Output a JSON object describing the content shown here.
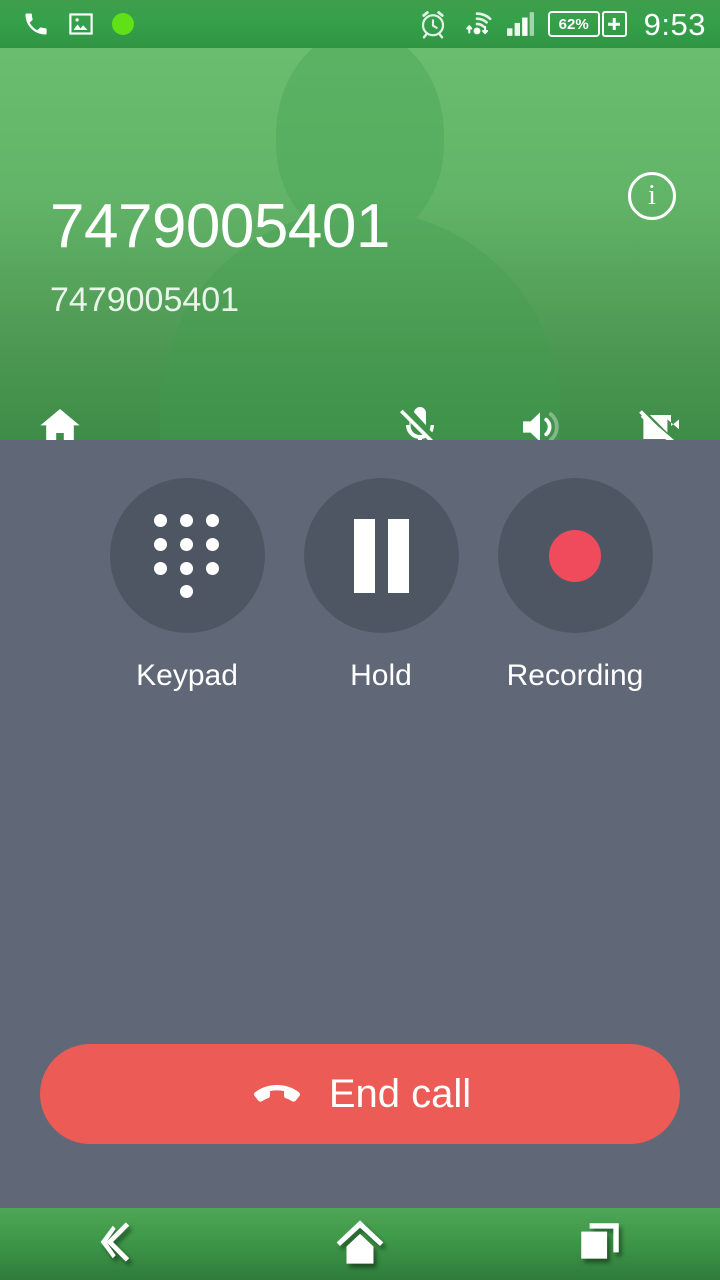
{
  "status_bar": {
    "time": "9:53",
    "battery_percent": "62%",
    "icons": [
      {
        "name": "phone-icon",
        "label": "call in progress"
      },
      {
        "name": "image-icon",
        "label": "screenshot captured"
      },
      {
        "name": "green-dot-icon",
        "label": "recording active"
      },
      {
        "name": "alarm-icon",
        "label": "alarm set"
      },
      {
        "name": "wifi-transfer-icon",
        "label": "wifi data transfer"
      },
      {
        "name": "signal-bars-icon",
        "label": "cellular signal"
      },
      {
        "name": "battery-icon",
        "label": "battery"
      },
      {
        "name": "plus-icon",
        "label": "battery plus"
      }
    ]
  },
  "call": {
    "caller_name": "7479005401",
    "caller_number": "7479005401",
    "info_glyph": "i",
    "header_actions": [
      {
        "name": "home-icon",
        "label": "Home"
      },
      {
        "name": "mic-off-icon",
        "label": "Mute"
      },
      {
        "name": "speaker-icon",
        "label": "Speaker"
      },
      {
        "name": "video-off-icon",
        "label": "Video off"
      }
    ]
  },
  "controls": [
    {
      "id": "keypad",
      "label": "Keypad",
      "icon": "dialpad-icon"
    },
    {
      "id": "hold",
      "label": "Hold",
      "icon": "pause-icon"
    },
    {
      "id": "recording",
      "label": "Recording",
      "icon": "record-dot-icon"
    }
  ],
  "end_call": {
    "label": "End call",
    "icon": "hangup-phone-icon"
  },
  "nav_bar": [
    {
      "name": "nav-back",
      "label": "Back"
    },
    {
      "name": "nav-home",
      "label": "Home"
    },
    {
      "name": "nav-recents",
      "label": "Recent apps"
    }
  ],
  "colors": {
    "header_green_top": "#6abd6e",
    "header_green_bottom": "#3d8c47",
    "status_bar_green": "#35a04a",
    "body_slate": "#606878",
    "control_circle": "#4f5663",
    "end_call_red": "#ec5b55",
    "record_red": "#ef4b5c",
    "status_dot_green": "#5fe017"
  }
}
